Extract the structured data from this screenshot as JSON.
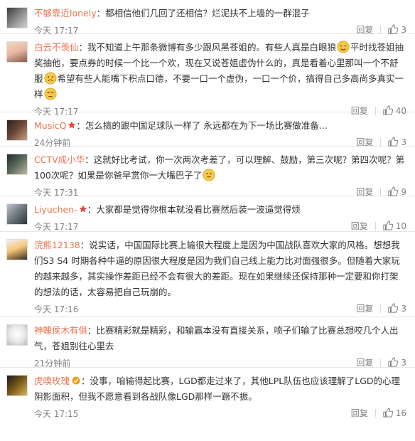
{
  "icons": {
    "like": "thumbs-up-icon",
    "badge": "star-badge-icon",
    "emoji": "emoji-icon"
  },
  "colors": {
    "username": "#eb7350",
    "meta": "#808080",
    "badge": "#e8433e"
  },
  "comments": [
    {
      "username": "不够靠近lonely",
      "segments": [
        "都相信他们几回了还相信？烂泥扶不上墙的一群混子"
      ],
      "time": "今天 17:17",
      "reply_label": "回复",
      "likes": "3"
    },
    {
      "username": "白云不羡仙",
      "segments": [
        "我不知道上午那条微博有多少跟风黑苍姐的。有些人真是白眼狼",
        "平时找苍姐抽奖抽他，要点券的时候一个比一个欢，现在又说苍姐虚伪什么的，真是看着心里那叫一个不舒服",
        "希望有些人能嘴下积点口德，不要一口一个虚伪，一口一个价，搞得自己多高尚多真实一样",
        ""
      ],
      "time": "今天 17:17",
      "reply_label": "回复",
      "likes": "40"
    },
    {
      "username": "MusicQ",
      "segments": [
        "怎么搞的跟中国足球队一样了 永远都在为下一场比赛做准备..."
      ],
      "time": "24分钟前",
      "reply_label": "回复",
      "likes": "3"
    },
    {
      "username": "CCTV成小华",
      "segments": [
        "这就好比考试，你一次两次考差了，可以理解、鼓励，第三次呢？第四次呢？第100次呢？如果是你爸早赏你一大嘴巴子了",
        ""
      ],
      "time": "今天 17:31",
      "reply_label": "回复",
      "likes": "9"
    },
    {
      "username": "Liyuchen-",
      "segments": [
        "大家都是觉得你根本就没看比赛然后装一波逼觉得烦"
      ],
      "time": "今天 17:17",
      "reply_label": "回复",
      "likes": "10"
    },
    {
      "username": "浣熊12138",
      "segments": [
        "说实话，中国国际比赛上输很大程度上是因为中国战队喜欢大家的风格。想想我们S3 S4 时期各种牛逼的原因很大程度是因为我们自己线上能力比对面强很多。但随着大家玩的越来越多，其实操作差距已经不会有很大的差距。现在如果继续还保持那种一定要和你打架的想法的话，太容易把自己玩崩的。"
      ],
      "time": "今天 17:16",
      "reply_label": "回复",
      "likes": "3"
    },
    {
      "username": "神魄侯木有俱",
      "segments": [
        "比赛精彩就是精彩，和输赢本没有直接关系，喷子们输了比赛总想咬几个人出气，苍姐别往心里去"
      ],
      "time": "21分钟前",
      "reply_label": "回复",
      "likes": "3"
    },
    {
      "username": "虎嗅玫瑰",
      "segments": [
        "没事，咱输得起比赛，LGD都走过来了，其他LPL队伍也应该理解了LGD的心理阴影面积，但我不愿意看到各战队像LGD那样一蹶不振。"
      ],
      "time": "今天 17:15",
      "reply_label": "回复",
      "likes": "16"
    }
  ]
}
